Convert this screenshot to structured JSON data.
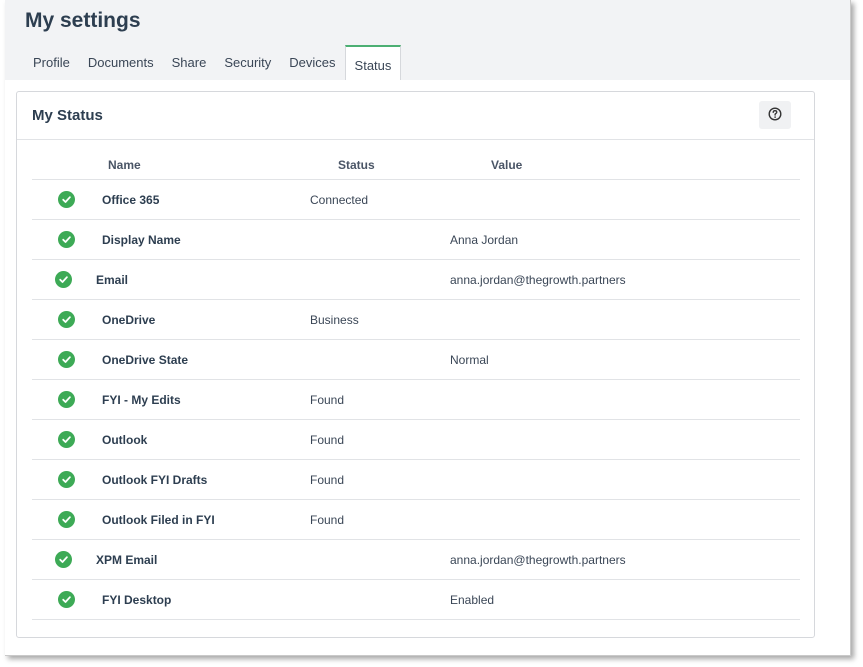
{
  "page": {
    "title": "My settings"
  },
  "tabs": [
    {
      "label": "Profile"
    },
    {
      "label": "Documents"
    },
    {
      "label": "Share"
    },
    {
      "label": "Security"
    },
    {
      "label": "Devices"
    },
    {
      "label": "Status",
      "active": true
    }
  ],
  "panel": {
    "title": "My Status",
    "help_icon": "question-circle-icon"
  },
  "table": {
    "headers": {
      "name": "Name",
      "status": "Status",
      "value": "Value"
    },
    "rows": [
      {
        "name": "Office 365",
        "status": "Connected",
        "value": ""
      },
      {
        "name": "Display Name",
        "status": "",
        "value": "Anna Jordan"
      },
      {
        "name": "Email",
        "status": "",
        "value": "anna.jordan@thegrowth.partners"
      },
      {
        "name": "OneDrive",
        "status": "Business",
        "value": ""
      },
      {
        "name": "OneDrive State",
        "status": "",
        "value": "Normal"
      },
      {
        "name": "FYI - My Edits",
        "status": "Found",
        "value": ""
      },
      {
        "name": "Outlook",
        "status": "Found",
        "value": ""
      },
      {
        "name": "Outlook FYI Drafts",
        "status": "Found",
        "value": ""
      },
      {
        "name": "Outlook Filed in FYI",
        "status": "Found",
        "value": ""
      },
      {
        "name": "XPM Email",
        "status": "",
        "value": "anna.jordan@thegrowth.partners"
      },
      {
        "name": "FYI Desktop",
        "status": "",
        "value": "Enabled"
      }
    ]
  },
  "colors": {
    "accent": "#4caf73",
    "check": "#3daa56",
    "title": "#2d3e50"
  }
}
